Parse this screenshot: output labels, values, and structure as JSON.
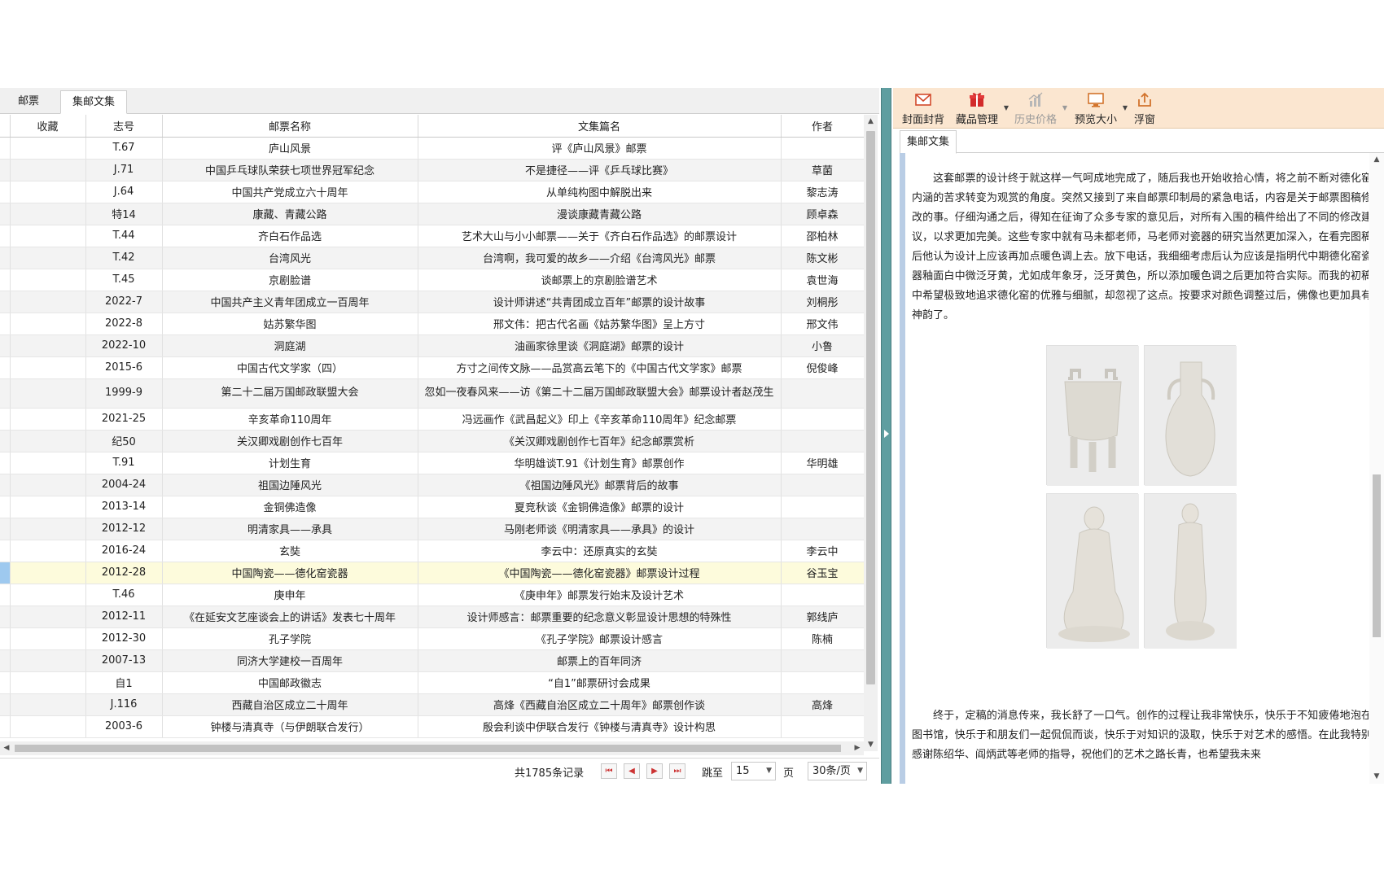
{
  "tabs": [
    {
      "label": "邮票"
    },
    {
      "label": "集邮文集"
    }
  ],
  "columns": {
    "fav": "收藏",
    "code": "志号",
    "name": "邮票名称",
    "article": "文集篇名",
    "author": "作者"
  },
  "rows": [
    {
      "code": "T.67",
      "name": "庐山风景",
      "article": "评《庐山风景》邮票",
      "author": ""
    },
    {
      "code": "J.71",
      "name": "中国乒乓球队荣获七项世界冠军纪念",
      "article": "不是捷径——评《乒乓球比赛》",
      "author": "草菌"
    },
    {
      "code": "J.64",
      "name": "中国共产党成立六十周年",
      "article": "从单纯构图中解脱出来",
      "author": "黎志涛"
    },
    {
      "code": "特14",
      "name": "康藏、青藏公路",
      "article": "漫谈康藏青藏公路",
      "author": "顾卓森"
    },
    {
      "code": "T.44",
      "name": "齐白石作品选",
      "article": "艺术大山与小小邮票——关于《齐白石作品选》的邮票设计",
      "author": "邵柏林"
    },
    {
      "code": "T.42",
      "name": "台湾风光",
      "article": "台湾啊，我可爱的故乡——介绍《台湾风光》邮票",
      "author": "陈文彬"
    },
    {
      "code": "T.45",
      "name": "京剧脸谱",
      "article": "谈邮票上的京剧脸谱艺术",
      "author": "袁世海"
    },
    {
      "code": "2022-7",
      "name": "中国共产主义青年团成立一百周年",
      "article": "设计师讲述“共青团成立百年”邮票的设计故事",
      "author": "刘桐彤"
    },
    {
      "code": "2022-8",
      "name": "姑苏繁华图",
      "article": "邢文伟：把古代名画《姑苏繁华图》呈上方寸",
      "author": "邢文伟"
    },
    {
      "code": "2022-10",
      "name": "洞庭湖",
      "article": "油画家徐里谈《洞庭湖》邮票的设计",
      "author": "小鲁"
    },
    {
      "code": "2015-6",
      "name": "中国古代文学家（四）",
      "article": "方寸之间传文脉——品赏高云笔下的《中国古代文学家》邮票",
      "author": "倪俊峰"
    },
    {
      "code": "1999-9",
      "name": "第二十二届万国邮政联盟大会",
      "article": "忽如一夜春风来——访《第二十二届万国邮政联盟大会》邮票设计者赵茂生",
      "author": ""
    },
    {
      "code": "2021-25",
      "name": "辛亥革命110周年",
      "article": "冯远画作《武昌起义》印上《辛亥革命110周年》纪念邮票",
      "author": ""
    },
    {
      "code": "纪50",
      "name": "关汉卿戏剧创作七百年",
      "article": "《关汉卿戏剧创作七百年》纪念邮票赏析",
      "author": ""
    },
    {
      "code": "T.91",
      "name": "计划生育",
      "article": "华明雄谈T.91《计划生育》邮票创作",
      "author": "华明雄"
    },
    {
      "code": "2004-24",
      "name": "祖国边陲风光",
      "article": "《祖国边陲风光》邮票背后的故事",
      "author": ""
    },
    {
      "code": "2013-14",
      "name": "金铜佛造像",
      "article": "夏竞秋谈《金铜佛造像》邮票的设计",
      "author": ""
    },
    {
      "code": "2012-12",
      "name": "明清家具——承具",
      "article": "马刚老师谈《明清家具——承具》的设计",
      "author": ""
    },
    {
      "code": "2016-24",
      "name": "玄奘",
      "article": "李云中：还原真实的玄奘",
      "author": "李云中"
    },
    {
      "code": "2012-28",
      "name": "中国陶瓷——德化窑瓷器",
      "article": "《中国陶瓷——德化窑瓷器》邮票设计过程",
      "author": "谷玉宝"
    },
    {
      "code": "T.46",
      "name": "庚申年",
      "article": "《庚申年》邮票发行始末及设计艺术",
      "author": ""
    },
    {
      "code": "2012-11",
      "name": "《在延安文艺座谈会上的讲话》发表七十周年",
      "article": "设计师感言：邮票重要的纪念意义彰显设计思想的特殊性",
      "author": "郭线庐"
    },
    {
      "code": "2012-30",
      "name": "孔子学院",
      "article": "《孔子学院》邮票设计感言",
      "author": "陈楠"
    },
    {
      "code": "2007-13",
      "name": "同济大学建校一百周年",
      "article": "邮票上的百年同济",
      "author": ""
    },
    {
      "code": "自1",
      "name": "中国邮政徽志",
      "article": "“自1”邮票研讨会成果",
      "author": ""
    },
    {
      "code": "J.116",
      "name": "西藏自治区成立二十周年",
      "article": "高烽《西藏自治区成立二十周年》邮票创作谈",
      "author": "高烽"
    },
    {
      "code": "2003-6",
      "name": "钟楼与清真寺（与伊朗联合发行）",
      "article": "殷会利谈中伊联合发行《钟楼与清真寺》设计构思",
      "author": ""
    }
  ],
  "pager": {
    "total": "共1785条记录",
    "goto": "跳至",
    "page_value": "15",
    "page_unit": "页",
    "page_size": "30条/页"
  },
  "toolbar": {
    "items": [
      {
        "label": "封面封背",
        "icon": "envelope-icon",
        "enabled": true
      },
      {
        "label": "藏品管理",
        "icon": "gift-box-icon",
        "enabled": true
      },
      {
        "label": "历史价格",
        "icon": "bar-chart-icon",
        "enabled": false
      },
      {
        "label": "预览大小",
        "icon": "monitor-icon",
        "enabled": true
      },
      {
        "label": "浮窗",
        "icon": "export-icon",
        "enabled": true
      }
    ]
  },
  "doc_tab": "集邮文集",
  "article": {
    "para1": "这套邮票的设计终于就这样一气呵成地完成了，随后我也开始收拾心情，将之前不断对德化窑内涵的苦求转变为观赏的角度。突然又接到了来自邮票印制局的紧急电话，内容是关于邮票图稿修改的事。仔细沟通之后，得知在征询了众多专家的意见后，对所有入围的稿件给出了不同的修改建议，以求更加完美。这些专家中就有马未都老师，马老师对瓷器的研究当然更加深入，在看完图稿后他认为设计上应该再加点暖色调上去。放下电话，我细细考虑后认为应该是指明代中期德化窑瓷器釉面白中微泛牙黄，尤如成年象牙，泛牙黄色，所以添加暖色调之后更加符合实际。而我的初稿中希望极致地追求德化窑的优雅与细腻，却忽视了这点。按要求对颜色调整过后，佛像也更加具有神韵了。",
    "para2": "终于，定稿的消息传来，我长舒了一口气。创作的过程让我非常快乐，快乐于不知疲倦地泡在图书馆，快乐于和朋友们一起侃侃而谈，快乐于对知识的汲取，快乐于对艺术的感悟。在此我特别感谢陈绍华、阎炳武等老师的指导，祝他们的艺术之路长青，也希望我未来"
  },
  "colors": {
    "splitter": "#5f9ea0",
    "toolbar_bg": "#fbe6d0",
    "selected_row": "#fdfbdc",
    "doc_border": "#b9cde5"
  }
}
